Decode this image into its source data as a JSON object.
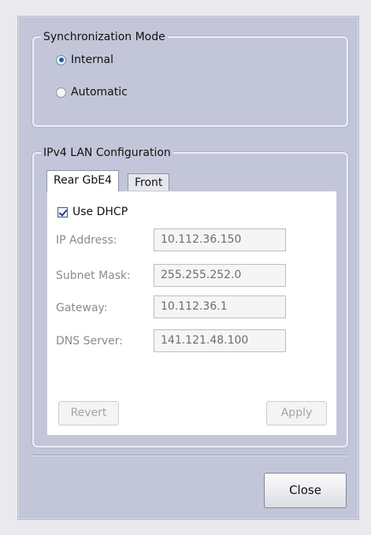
{
  "sync_mode": {
    "legend": "Synchronization Mode",
    "options": [
      {
        "label": "Internal",
        "selected": true
      },
      {
        "label": "Automatic",
        "selected": false
      }
    ]
  },
  "lan_config": {
    "legend": "IPv4 LAN Configuration",
    "tabs": [
      {
        "label": "Rear GbE4",
        "active": true
      },
      {
        "label": "Front",
        "active": false
      }
    ],
    "use_dhcp": {
      "label": "Use DHCP",
      "checked": true
    },
    "fields": [
      {
        "label": "IP Address:",
        "value": "10.112.36.150"
      },
      {
        "label": "Subnet Mask:",
        "value": "255.255.252.0"
      },
      {
        "label": "Gateway:",
        "value": "10.112.36.1"
      },
      {
        "label": "DNS Server:",
        "value": "141.121.48.100"
      }
    ],
    "revert_label": "Revert",
    "apply_label": "Apply"
  },
  "footer": {
    "close_label": "Close"
  }
}
